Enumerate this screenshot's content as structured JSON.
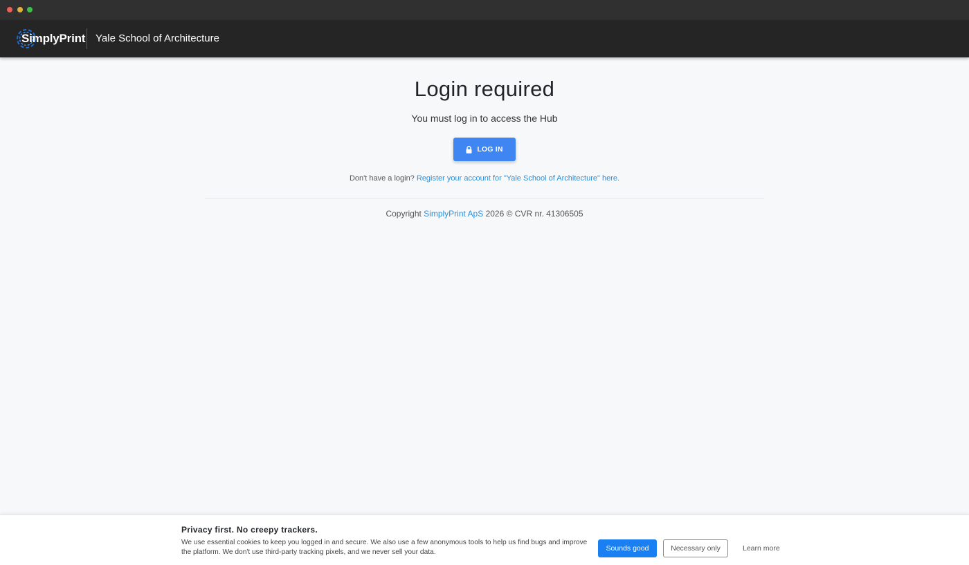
{
  "header": {
    "brand": "SimplyPrint",
    "organization": "Yale School of Architecture"
  },
  "main": {
    "title": "Login required",
    "subtitle": "You must log in to access the Hub",
    "login_button": "LOG IN",
    "register_prompt": "Don't have a login?",
    "register_link": "Register your account for \"Yale School of Architecture\" here.",
    "copyright_prefix": "Copyright",
    "copyright_link": "SimplyPrint ApS",
    "copyright_suffix": "2026 © CVR nr. 41306505"
  },
  "cookie_banner": {
    "title": "Privacy first. No creepy trackers.",
    "text": "We use essential cookies to keep you logged in and secure. We also use a few anonymous tools to help us find bugs and improve the platform. We don't use third-party tracking pixels, and we never sell your data.",
    "accept_button": "Sounds good",
    "necessary_button": "Necessary only",
    "learn_more": "Learn more"
  },
  "colors": {
    "primary": "#3f86f2",
    "link": "#2d8fd6",
    "header_bg": "#252525",
    "page_bg": "#f7f8fa"
  },
  "icons": {
    "login": "lock-icon",
    "brand": "simplyprint-logo"
  }
}
